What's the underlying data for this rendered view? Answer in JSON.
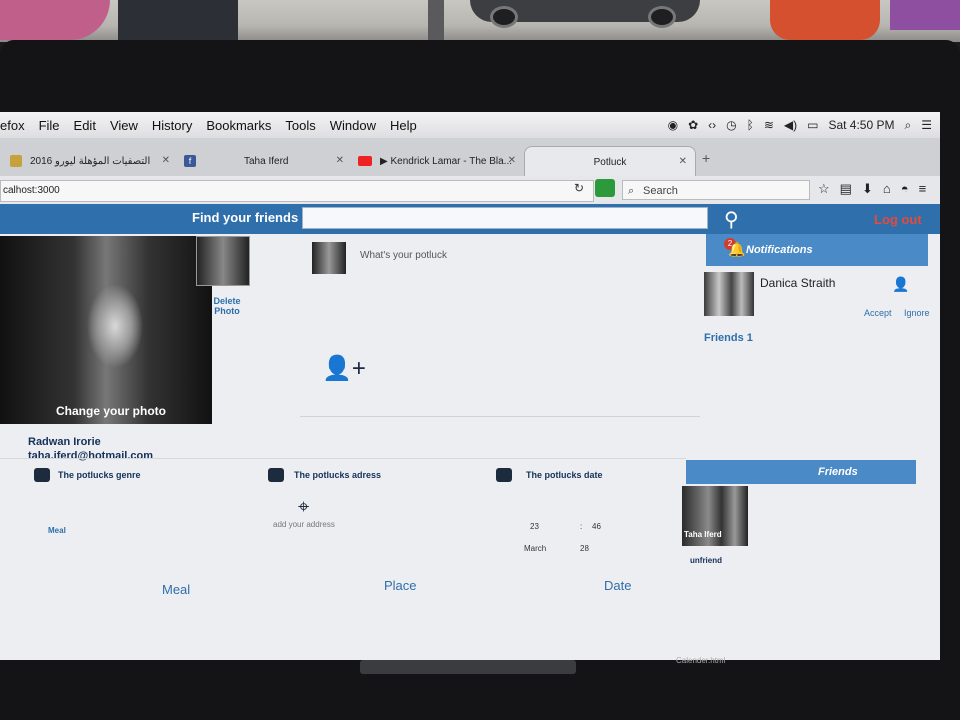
{
  "menubar": {
    "items": [
      "efox",
      "File",
      "Edit",
      "View",
      "History",
      "Bookmarks",
      "Tools",
      "Window",
      "Help"
    ],
    "clock": "Sat 4:50 PM"
  },
  "tabs": [
    {
      "label": "التصفيات المؤهلة ليورو 2016"
    },
    {
      "label": "Taha Iferd"
    },
    {
      "label": "▶ Kendrick Lamar - The Bla..."
    },
    {
      "label": "Potluck"
    }
  ],
  "address_bar": {
    "url": "calhost:3000"
  },
  "search_box": {
    "placeholder": "Search"
  },
  "header": {
    "find_label": "Find your friends",
    "logout_label": "Log out"
  },
  "profile": {
    "change_photo_label": "Change your photo",
    "delete_photo_label_1": "Delete",
    "delete_photo_label_2": "Photo",
    "name": "Radwan Irorie",
    "email": "taha.iferd@hotmail.com"
  },
  "post": {
    "prompt": "What's your potluck"
  },
  "notifications": {
    "badge_count": "2",
    "title": "Notifications",
    "request_name": "Danica Straith",
    "accept_label": "Accept",
    "ignore_label": "Ignore",
    "friends_count_label": "Friends 1"
  },
  "potluck": {
    "genre_title": "The potlucks genre",
    "genre_value": "Meal",
    "address_title": "The potlucks adress",
    "address_placeholder": "add your address",
    "date_title": "The potlucks date",
    "hour": "23",
    "colon": ":",
    "minute": "46",
    "month": "March",
    "day": "28",
    "tab_meal": "Meal",
    "tab_place": "Place",
    "tab_date": "Date"
  },
  "friends_panel": {
    "title": "Friends",
    "friend_name": "Taha Iferd",
    "unfriend_label": "unfriend"
  },
  "dock": {
    "file_label": "Calender.html"
  }
}
